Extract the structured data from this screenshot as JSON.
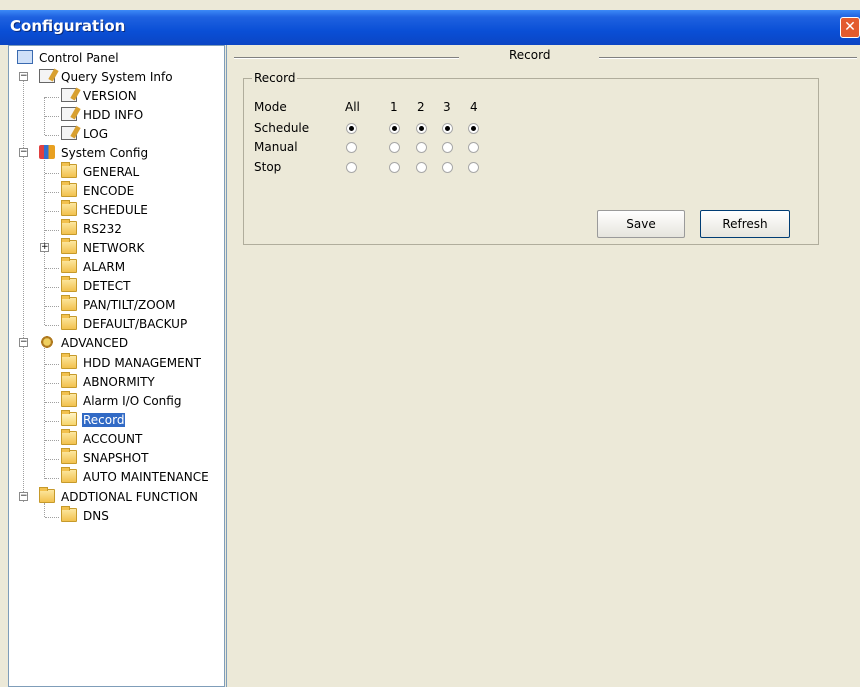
{
  "window": {
    "title": "Configuration",
    "close_glyph": "✕"
  },
  "tree": {
    "root": "Control Panel",
    "query": {
      "label": "Query System Info",
      "items": [
        "VERSION",
        "HDD INFO",
        "LOG"
      ]
    },
    "system": {
      "label": "System Config",
      "items": [
        "GENERAL",
        "ENCODE",
        "SCHEDULE",
        "RS232",
        "NETWORK",
        "ALARM",
        "DETECT",
        "PAN/TILT/ZOOM",
        "DEFAULT/BACKUP"
      ]
    },
    "advanced": {
      "label": "ADVANCED",
      "items": [
        "HDD MANAGEMENT",
        "ABNORMITY",
        "Alarm I/O Config",
        "Record",
        "ACCOUNT",
        "SNAPSHOT",
        "AUTO MAINTENANCE"
      ]
    },
    "addtional": {
      "label": "ADDTIONAL FUNCTION",
      "items": [
        "DNS"
      ]
    },
    "selected": "Record"
  },
  "panel": {
    "header": "Record",
    "group_title": "Record",
    "mode_label": "Mode",
    "columns": [
      "All",
      "1",
      "2",
      "3",
      "4"
    ],
    "rows": [
      {
        "label": "Schedule",
        "selected": [
          true,
          true,
          true,
          true,
          true
        ]
      },
      {
        "label": "Manual",
        "selected": [
          false,
          false,
          false,
          false,
          false
        ]
      },
      {
        "label": "Stop",
        "selected": [
          false,
          false,
          false,
          false,
          false
        ]
      }
    ],
    "save_label": "Save",
    "refresh_label": "Refresh"
  }
}
